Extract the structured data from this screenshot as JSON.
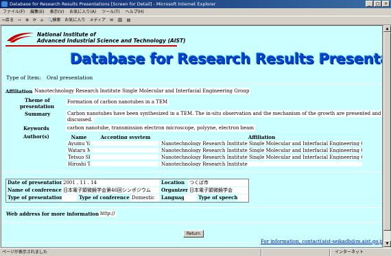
{
  "window": {
    "title": "Database for Research Results Presentations [Screen for Detail] - Microsoft Internet Explorer",
    "buttons": [
      "_",
      "□",
      "×"
    ]
  },
  "menubar": [
    "ファイル(F)",
    "編集(E)",
    "表示(V)",
    "お気に入り(A)",
    "ツール(T)",
    "ヘルプ(H)"
  ],
  "toolbar": [
    "⇦戻る",
    "⇨",
    "⊗",
    "⟳",
    "⌂",
    "🔍検索",
    "お気に入り",
    "メディア",
    "✉",
    "🖨",
    "▤"
  ],
  "logo": {
    "line1": "National Institute of",
    "line2": "Advanced Industrial Science and Technology (AIST)"
  },
  "banner": "Database for Research Results Presentations",
  "item_type": {
    "label": "Type of Item:",
    "value": "Oral presentation"
  },
  "affiliation": {
    "label": "Affiliation",
    "value": "Nanotechnology Research Institute Single Molecular and Interfacial Engineering Group"
  },
  "theme": {
    "label1": "Theme of",
    "label2": "presentation",
    "value": "Formation of carbon nanotubes in a TEM"
  },
  "summary": {
    "label": "Summary",
    "line1": "Carbon nanotubes have been synthesized in a TEM. The in-situ observation and the mechanism of the growth are presented and",
    "line2": "discussed."
  },
  "keywords": {
    "label": "Keywords",
    "value": "carbon nanotube, transmission electron microscope, polyyne, electron beam"
  },
  "authors": {
    "label": "Author(s)",
    "headers": [
      "Name",
      "Accepting sysytem",
      "Affiliation"
    ],
    "rows": [
      [
        "Ayumu Yasuda",
        "",
        "Nanotechnology Research Institute Single Molecular and Interfacial Engineering Group"
      ],
      [
        "Wataru Mizutani",
        "",
        "Nanotechnology Research Institute Single Molecular and Interfacial Engineering Group"
      ],
      [
        "Tetsuo Shimizu",
        "",
        "Nanotechnology Research Institute Single Molecular and Interfacial Engineering Group"
      ],
      [
        "Hiroshi Tokumoto",
        "",
        "Nanotechnology Research Institute"
      ]
    ]
  },
  "presentation": {
    "date_label": "Date of presentation",
    "date_value": "2001 . 11 . 14",
    "location_label": "Location",
    "location_value": "つくば市",
    "conference_label": "Name of conference",
    "conference_value": "日本電子顕微鏡学会第46回シンポジウム",
    "organizer_label": "Organizer",
    "organizer_value": "日本電子顕微鏡学会",
    "type_pres_label": "Type of presentation",
    "type_pres_value": "",
    "type_conf_label": "Type of conference",
    "type_conf_value": "Domestic",
    "language_label": "Language",
    "language_value": "",
    "type_speech_label": "Type of speech",
    "type_speech_value": ""
  },
  "web": {
    "label": "Web address for more informations",
    "value": "http://"
  },
  "return_button": "Return",
  "contact": "For information, contact(aist-seikadb@m.aist.go.jp)",
  "status": {
    "left": "ページが表示されました",
    "right": "インターネット"
  }
}
